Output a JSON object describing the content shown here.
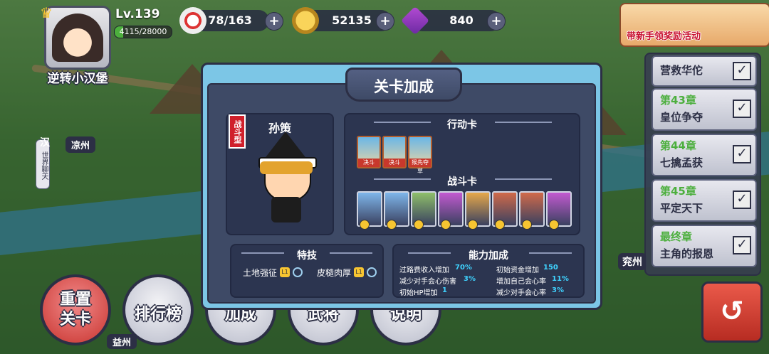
{
  "player": {
    "name": "逆转小汉堡",
    "level": "Lv.139",
    "exp": "4115/28000",
    "exp_fraction": 0.147
  },
  "resources": [
    {
      "icon": "dice-icon",
      "value": "78/163"
    },
    {
      "icon": "gold-coin-icon",
      "value": "52135"
    },
    {
      "icon": "diamond-icon",
      "value": "840"
    }
  ],
  "event": {
    "text": "带新手领奖励活动"
  },
  "map": {
    "world_chat": "世界聊天",
    "faction": "汉",
    "city_left": "凉州",
    "city_bottom": "益州",
    "city_right": "兖州"
  },
  "chapters": [
    {
      "num": "",
      "title": "营救华佗"
    },
    {
      "num": "第43章",
      "title": "皇位争夺"
    },
    {
      "num": "第44章",
      "title": "七擒孟获"
    },
    {
      "num": "第45章",
      "title": "平定天下"
    },
    {
      "num": "最终章",
      "title": "主角的报恩"
    }
  ],
  "buttons": {
    "reset": [
      "重置",
      "关卡"
    ],
    "rank": "排行榜",
    "bonus": "加成",
    "generals": "武将",
    "help": "说明"
  },
  "dialog": {
    "title": "关卡加成",
    "character": {
      "name": "孙策",
      "type": "战斗型"
    },
    "action_cards": {
      "header": "行动卡",
      "tags": [
        "决斗",
        "决斗",
        "猴先夺草"
      ]
    },
    "battle_cards": {
      "header": "战斗卡",
      "colors": [
        "#7fb6ea",
        "#7fb6ea",
        "#8fbf6a",
        "#c25ad0",
        "#e6a84a",
        "#d06a4a",
        "#d06a4a",
        "#c25ad0"
      ]
    },
    "traits": {
      "header": "特技",
      "items": [
        "土地强征",
        "皮糙肉厚"
      ],
      "level_glyph": "L1"
    },
    "abilities": {
      "header": "能力加成",
      "left": [
        {
          "label": "过路费收入增加",
          "value": "70%"
        },
        {
          "label": "减少对手会心伤害",
          "value": "3%"
        },
        {
          "label": "初始HP增加",
          "value": "1"
        }
      ],
      "right": [
        {
          "label": "初始资金增加",
          "value": "150"
        },
        {
          "label": "增加自己会心率",
          "value": "11%"
        },
        {
          "label": "减少对手会心率",
          "value": "3%"
        }
      ]
    }
  }
}
